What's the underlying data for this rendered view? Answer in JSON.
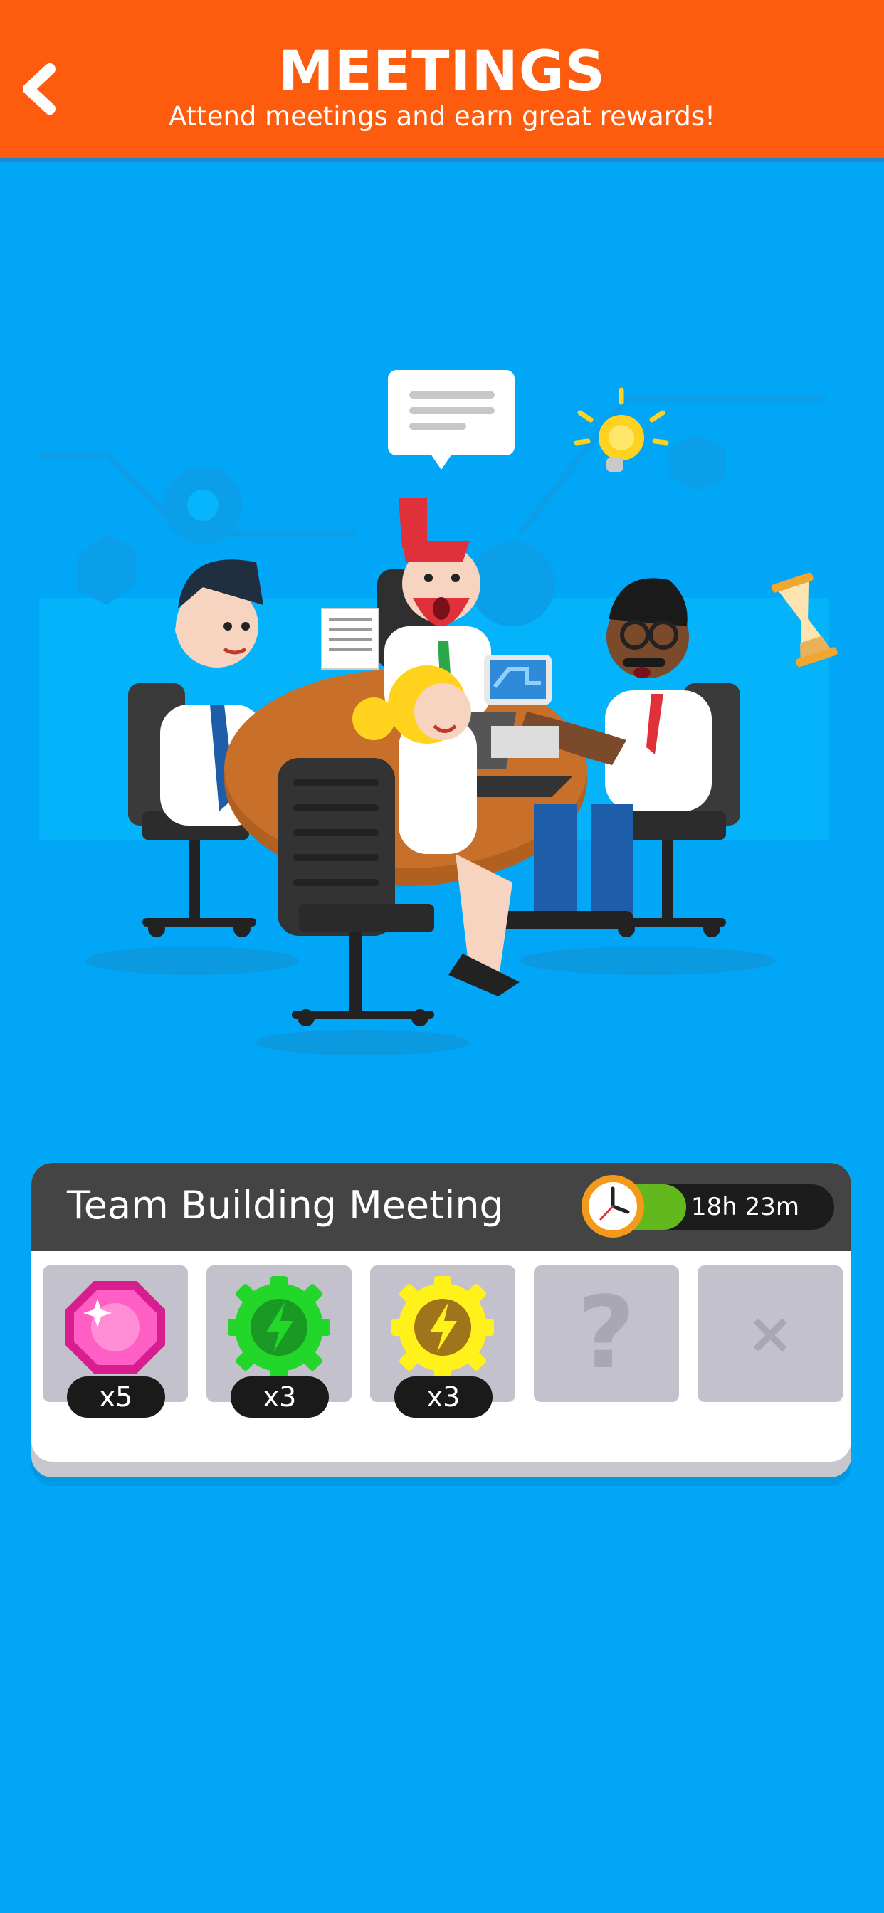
{
  "header": {
    "title": "MEETINGS",
    "subtitle": "Attend meetings and earn great rewards!",
    "back_icon": "chevron-left-icon"
  },
  "meeting": {
    "name": "Team Building Meeting",
    "timer": "18h 23m",
    "timer_progress": 0.35,
    "rewards": [
      {
        "icon": "pink-gem-icon",
        "quantity": "x5"
      },
      {
        "icon": "green-lightning-gear-icon",
        "quantity": "x3"
      },
      {
        "icon": "yellow-lightning-gear-icon",
        "quantity": "x3"
      },
      {
        "icon": "question-mark-icon",
        "symbol": "?"
      },
      {
        "icon": "close-x-icon",
        "symbol": "×"
      }
    ]
  },
  "colors": {
    "background": "#02a6f7",
    "header": "#fd5c0e",
    "card_header": "#444444",
    "timer_fill": "#63b81d",
    "slot": "#c3c1cb"
  }
}
